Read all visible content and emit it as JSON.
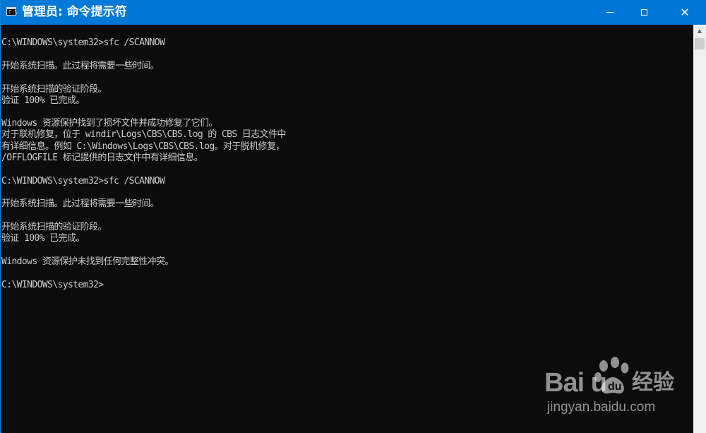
{
  "window": {
    "title": "管理员: 命令提示符",
    "app_icon_glyph": "C:\\",
    "controls": {
      "minimize": "minimize",
      "maximize": "maximize",
      "close": "✕"
    }
  },
  "console": {
    "lines": [
      "C:\\WINDOWS\\system32>sfc /SCANNOW",
      "开始系统扫描。此过程将需要一些时间。",
      "开始系统扫描的验证阶段。",
      "验证 100% 已完成。",
      "Windows 资源保护找到了损坏文件并成功修复了它们。",
      "对于联机修复，位于 windir\\Logs\\CBS\\CBS.log 的 CBS 日志文件中",
      "有详细信息。例如 C:\\Windows\\Logs\\CBS\\CBS.log。对于脱机修复，",
      "/OFFLOGFILE 标记提供的日志文件中有详细信息。",
      "C:\\WINDOWS\\system32>sfc /SCANNOW",
      "开始系统扫描。此过程将需要一些时间。",
      "开始系统扫描的验证阶段。",
      "验证 100% 已完成。",
      "Windows 资源保护未找到任何完整性冲突。",
      "C:\\WINDOWS\\system32>"
    ]
  },
  "scrollbar": {
    "up_arrow": "▲"
  },
  "watermark": {
    "brand": "Bai  u",
    "brand_cn": "经验",
    "url": "jingyan.baidu.com"
  }
}
